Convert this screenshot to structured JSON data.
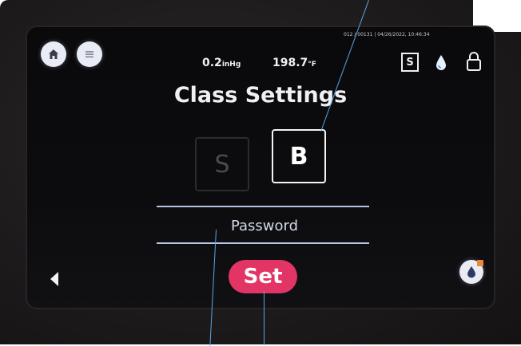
{
  "header": {
    "home_icon": "home-icon",
    "menu_icon": "menu-icon",
    "pressure_value": "0.2",
    "pressure_unit": "inHg",
    "temperature_value": "198.7",
    "temperature_unit": "°F",
    "timestamp": "012 / 00131 | 04/26/2022, 10:46:34",
    "class_badge": "S",
    "water_icon": "water-drop-icon",
    "lock_icon": "lock-icon"
  },
  "page": {
    "title": "Class Settings"
  },
  "class_options": {
    "s_label": "S",
    "b_label": "B",
    "selected": "B"
  },
  "password": {
    "placeholder": "Password",
    "value": ""
  },
  "footer": {
    "back_icon": "back-arrow-icon",
    "set_label": "Set",
    "corner_icon": "water-drop-icon"
  },
  "colors": {
    "accent": "#e23465",
    "screen": "#0b0b0d",
    "annotation_line": "#5ca4e2"
  }
}
